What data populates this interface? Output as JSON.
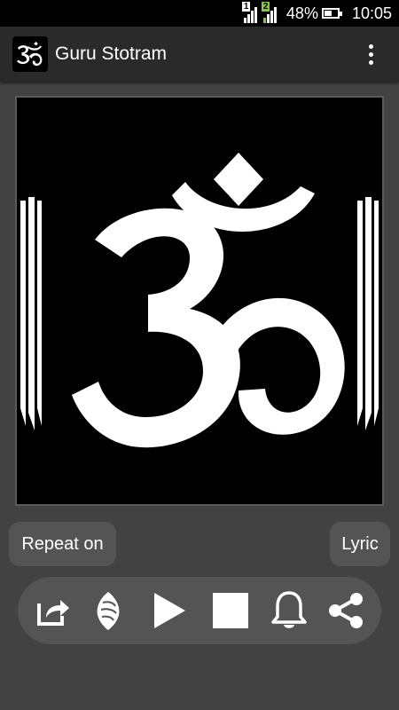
{
  "status_bar": {
    "sim1_badge": "1",
    "sim2_badge": "2",
    "battery_percent": "48%",
    "battery_level": 0.48,
    "time": "10:05"
  },
  "app_bar": {
    "title": "Guru Stotram",
    "logo_icon": "om-logo-icon",
    "menu_icon": "overflow-menu-icon"
  },
  "artwork": {
    "icon": "om-symbol-artwork",
    "background": "#000000",
    "foreground": "#ffffff"
  },
  "buttons": {
    "repeat_label": "Repeat on",
    "lyric_label": "Lyric"
  },
  "controls": [
    {
      "name": "open-external-icon"
    },
    {
      "name": "conch-shell-icon"
    },
    {
      "name": "play-icon"
    },
    {
      "name": "stop-icon"
    },
    {
      "name": "bell-icon"
    },
    {
      "name": "share-icon"
    }
  ],
  "colors": {
    "background": "#424242",
    "app_bar": "#2a2a2a",
    "button": "#545454",
    "text": "#ffffff",
    "sim2_accent": "#8bc34a"
  }
}
